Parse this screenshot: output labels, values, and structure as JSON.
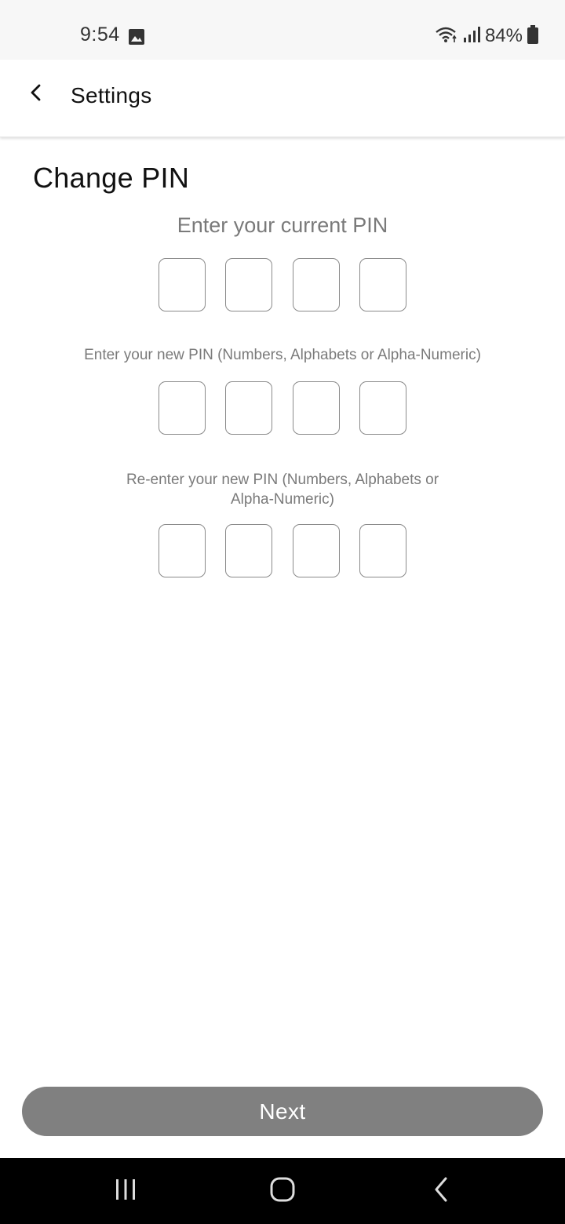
{
  "status_bar": {
    "time": "9:54",
    "battery": "84%",
    "icons": [
      "image-icon",
      "wifi-icon",
      "signal-icon",
      "battery-icon"
    ]
  },
  "app_bar": {
    "title": "Settings",
    "back_icon": "chevron-left-icon"
  },
  "page": {
    "title": "Change PIN",
    "current_pin_label": "Enter your current PIN",
    "new_pin_label": "Enter your new PIN (Numbers, Alphabets or Alpha-Numeric)",
    "reenter_pin_label": "Re-enter your new PIN (Numbers, Alphabets or Alpha-Numeric)",
    "current_pin": [
      "",
      "",
      "",
      ""
    ],
    "new_pin": [
      "",
      "",
      "",
      ""
    ],
    "reenter_pin": [
      "",
      "",
      "",
      ""
    ]
  },
  "actions": {
    "next_label": "Next"
  },
  "colors": {
    "button_bg": "#808080",
    "label_text": "#7a7a7a",
    "box_border": "#8a8a8a",
    "nav_bar": "#000000"
  },
  "nav_bar": {
    "icons": [
      "recent-apps-icon",
      "home-icon",
      "back-icon"
    ]
  }
}
